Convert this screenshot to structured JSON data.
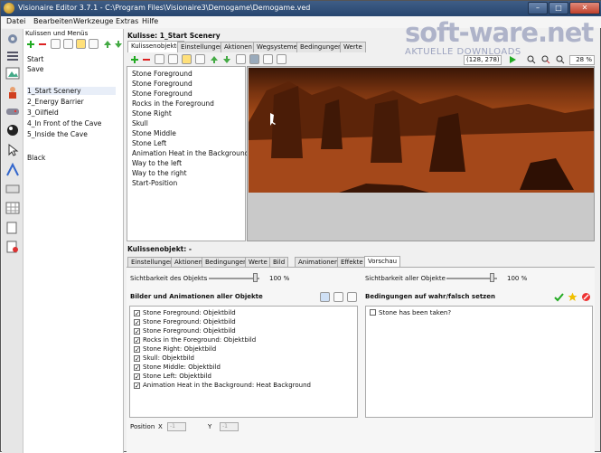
{
  "window": {
    "title": "Visionaire Editor 3.7.1 - C:\\Program Files\\Visionaire3\\Demogame\\Demogame.ved"
  },
  "menu": [
    "Datei",
    "Bearbeiten",
    "Werkzeuge",
    "Extras",
    "Hilfe"
  ],
  "left_panel": {
    "header": "Kulissen und Menüs",
    "items": [
      "Start",
      "Save",
      "1_Start Scenery",
      "2_Energy Barrier",
      "3_Oilfield",
      "4_In Front of the Cave",
      "5_Inside the Cave",
      "Black"
    ],
    "selected": "1_Start Scenery"
  },
  "kulisse": {
    "title": "Kulisse: 1_Start Scenery",
    "tabs": [
      "Kulissenobjekte",
      "Einstellungen",
      "Aktionen",
      "Wegsysteme",
      "Bedingungen",
      "Werte"
    ],
    "active_tab": "Kulissenobjekte",
    "objects": [
      "Stone Foreground",
      "Stone Foreground",
      "Stone Foreground",
      "Rocks in the Foreground",
      "Stone Right",
      "Skull",
      "Stone Middle",
      "Stone Left",
      "Animation Heat in the Background",
      "Way to the left",
      "Way to the right",
      "Start-Position"
    ],
    "coords": "(128, 278)",
    "zoom": "28 %"
  },
  "watermark": {
    "brand": "soft-ware.net",
    "sub": "AKTUELLE DOWNLOADS"
  },
  "kulissenobjekt": {
    "title": "Kulissenobjekt: -",
    "tabs": [
      "Einstellungen",
      "Aktionen",
      "Bedingungen",
      "Werte",
      "Bild",
      "Animationen",
      "Effekte",
      "Vorschau"
    ],
    "active_tab": "Vorschau",
    "visibility_objects_label": "Sichtbarkeit des Objekts",
    "visibility_objects_value": "100 %",
    "visibility_all_label": "Sichtbarkeit aller Objekte",
    "visibility_all_value": "100 %",
    "images_header": "Bilder und Animationen aller Objekte",
    "images": [
      "Stone Foreground: Objektbild",
      "Stone Foreground: Objektbild",
      "Stone Foreground: Objektbild",
      "Rocks in the Foreground: Objektbild",
      "Stone Right: Objektbild",
      "Skull: Objektbild",
      "Stone Middle: Objektbild",
      "Stone Left: Objektbild",
      "Animation Heat in the Background: Heat Background"
    ],
    "conditions_header": "Bedingungen auf wahr/falsch setzen",
    "conditions": [
      "Stone has been taken?"
    ],
    "position_label": "Position",
    "x_label": "X",
    "y_label": "Y",
    "x_value": "-1",
    "y_value": "-1"
  },
  "colors": {
    "titlebar": "#27466f",
    "scene": "#b3521a"
  }
}
